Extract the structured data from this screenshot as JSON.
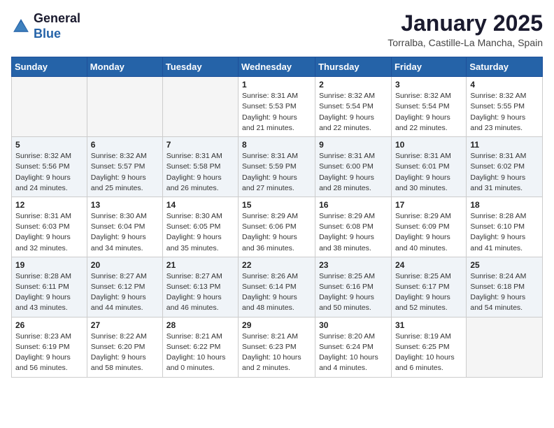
{
  "header": {
    "logo_line1": "General",
    "logo_line2": "Blue",
    "title": "January 2025",
    "subtitle": "Torralba, Castille-La Mancha, Spain"
  },
  "days_of_week": [
    "Sunday",
    "Monday",
    "Tuesday",
    "Wednesday",
    "Thursday",
    "Friday",
    "Saturday"
  ],
  "weeks": [
    [
      {
        "day": "",
        "info": ""
      },
      {
        "day": "",
        "info": ""
      },
      {
        "day": "",
        "info": ""
      },
      {
        "day": "1",
        "info": "Sunrise: 8:31 AM\nSunset: 5:53 PM\nDaylight: 9 hours\nand 21 minutes."
      },
      {
        "day": "2",
        "info": "Sunrise: 8:32 AM\nSunset: 5:54 PM\nDaylight: 9 hours\nand 22 minutes."
      },
      {
        "day": "3",
        "info": "Sunrise: 8:32 AM\nSunset: 5:54 PM\nDaylight: 9 hours\nand 22 minutes."
      },
      {
        "day": "4",
        "info": "Sunrise: 8:32 AM\nSunset: 5:55 PM\nDaylight: 9 hours\nand 23 minutes."
      }
    ],
    [
      {
        "day": "5",
        "info": "Sunrise: 8:32 AM\nSunset: 5:56 PM\nDaylight: 9 hours\nand 24 minutes."
      },
      {
        "day": "6",
        "info": "Sunrise: 8:32 AM\nSunset: 5:57 PM\nDaylight: 9 hours\nand 25 minutes."
      },
      {
        "day": "7",
        "info": "Sunrise: 8:31 AM\nSunset: 5:58 PM\nDaylight: 9 hours\nand 26 minutes."
      },
      {
        "day": "8",
        "info": "Sunrise: 8:31 AM\nSunset: 5:59 PM\nDaylight: 9 hours\nand 27 minutes."
      },
      {
        "day": "9",
        "info": "Sunrise: 8:31 AM\nSunset: 6:00 PM\nDaylight: 9 hours\nand 28 minutes."
      },
      {
        "day": "10",
        "info": "Sunrise: 8:31 AM\nSunset: 6:01 PM\nDaylight: 9 hours\nand 30 minutes."
      },
      {
        "day": "11",
        "info": "Sunrise: 8:31 AM\nSunset: 6:02 PM\nDaylight: 9 hours\nand 31 minutes."
      }
    ],
    [
      {
        "day": "12",
        "info": "Sunrise: 8:31 AM\nSunset: 6:03 PM\nDaylight: 9 hours\nand 32 minutes."
      },
      {
        "day": "13",
        "info": "Sunrise: 8:30 AM\nSunset: 6:04 PM\nDaylight: 9 hours\nand 34 minutes."
      },
      {
        "day": "14",
        "info": "Sunrise: 8:30 AM\nSunset: 6:05 PM\nDaylight: 9 hours\nand 35 minutes."
      },
      {
        "day": "15",
        "info": "Sunrise: 8:29 AM\nSunset: 6:06 PM\nDaylight: 9 hours\nand 36 minutes."
      },
      {
        "day": "16",
        "info": "Sunrise: 8:29 AM\nSunset: 6:08 PM\nDaylight: 9 hours\nand 38 minutes."
      },
      {
        "day": "17",
        "info": "Sunrise: 8:29 AM\nSunset: 6:09 PM\nDaylight: 9 hours\nand 40 minutes."
      },
      {
        "day": "18",
        "info": "Sunrise: 8:28 AM\nSunset: 6:10 PM\nDaylight: 9 hours\nand 41 minutes."
      }
    ],
    [
      {
        "day": "19",
        "info": "Sunrise: 8:28 AM\nSunset: 6:11 PM\nDaylight: 9 hours\nand 43 minutes."
      },
      {
        "day": "20",
        "info": "Sunrise: 8:27 AM\nSunset: 6:12 PM\nDaylight: 9 hours\nand 44 minutes."
      },
      {
        "day": "21",
        "info": "Sunrise: 8:27 AM\nSunset: 6:13 PM\nDaylight: 9 hours\nand 46 minutes."
      },
      {
        "day": "22",
        "info": "Sunrise: 8:26 AM\nSunset: 6:14 PM\nDaylight: 9 hours\nand 48 minutes."
      },
      {
        "day": "23",
        "info": "Sunrise: 8:25 AM\nSunset: 6:16 PM\nDaylight: 9 hours\nand 50 minutes."
      },
      {
        "day": "24",
        "info": "Sunrise: 8:25 AM\nSunset: 6:17 PM\nDaylight: 9 hours\nand 52 minutes."
      },
      {
        "day": "25",
        "info": "Sunrise: 8:24 AM\nSunset: 6:18 PM\nDaylight: 9 hours\nand 54 minutes."
      }
    ],
    [
      {
        "day": "26",
        "info": "Sunrise: 8:23 AM\nSunset: 6:19 PM\nDaylight: 9 hours\nand 56 minutes."
      },
      {
        "day": "27",
        "info": "Sunrise: 8:22 AM\nSunset: 6:20 PM\nDaylight: 9 hours\nand 58 minutes."
      },
      {
        "day": "28",
        "info": "Sunrise: 8:21 AM\nSunset: 6:22 PM\nDaylight: 10 hours\nand 0 minutes."
      },
      {
        "day": "29",
        "info": "Sunrise: 8:21 AM\nSunset: 6:23 PM\nDaylight: 10 hours\nand 2 minutes."
      },
      {
        "day": "30",
        "info": "Sunrise: 8:20 AM\nSunset: 6:24 PM\nDaylight: 10 hours\nand 4 minutes."
      },
      {
        "day": "31",
        "info": "Sunrise: 8:19 AM\nSunset: 6:25 PM\nDaylight: 10 hours\nand 6 minutes."
      },
      {
        "day": "",
        "info": ""
      }
    ]
  ]
}
